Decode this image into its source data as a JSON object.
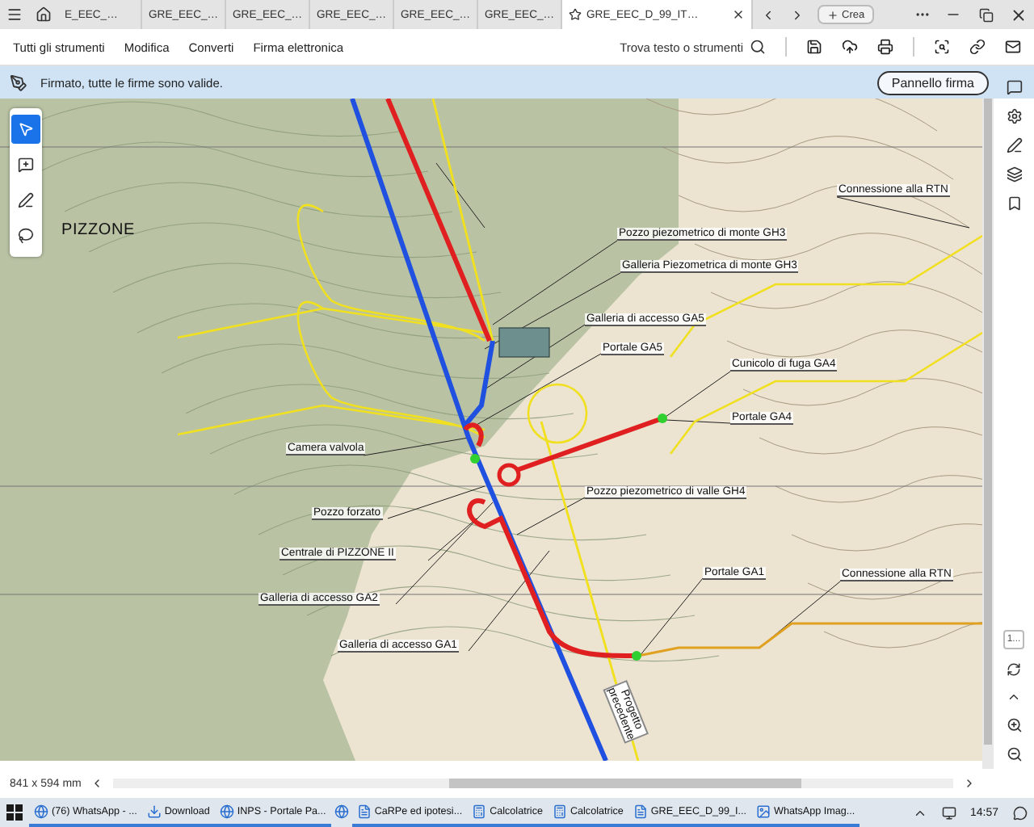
{
  "tabs": [
    {
      "label": "E_EEC_…",
      "selected": false
    },
    {
      "label": "GRE_EEC_…",
      "selected": false
    },
    {
      "label": "GRE_EEC_…",
      "selected": false
    },
    {
      "label": "GRE_EEC_…",
      "selected": false
    },
    {
      "label": "GRE_EEC_…",
      "selected": false
    },
    {
      "label": "GRE_EEC_…",
      "selected": false
    },
    {
      "label": "GRE_EEC_D_99_IT…",
      "selected": true
    }
  ],
  "create_button": "Crea",
  "menu": [
    "Tutti gli strumenti",
    "Modifica",
    "Converti",
    "Firma elettronica"
  ],
  "search": {
    "placeholder": "Trova testo o strumenti"
  },
  "signature_bar": {
    "message": "Firmato, tutte le firme sono valide.",
    "button": "Pannello firma"
  },
  "tools": [
    {
      "selected": true
    },
    {
      "selected": false
    },
    {
      "selected": false
    },
    {
      "selected": false
    }
  ],
  "map": {
    "labels": [
      {
        "kind": "place",
        "text": "PIZZONE"
      },
      {
        "kind": "callout",
        "text": "Connessione alla RTN"
      },
      {
        "kind": "callout",
        "text": "Pozzo piezometrico di  monte GH3"
      },
      {
        "kind": "callout",
        "text": "Galleria Piezometrica di  monte GH3"
      },
      {
        "kind": "callout",
        "text": "Galleria di accesso GA5"
      },
      {
        "kind": "callout",
        "text": "Portale GA5"
      },
      {
        "kind": "callout",
        "text": "Cunicolo di fuga GA4"
      },
      {
        "kind": "callout",
        "text": "Portale GA4"
      },
      {
        "kind": "callout",
        "text": "Camera valvola"
      },
      {
        "kind": "callout",
        "text": "Pozzo piezometrico di valle GH4"
      },
      {
        "kind": "callout",
        "text": "Pozzo forzato"
      },
      {
        "kind": "callout",
        "text": "Centrale di PIZZONE II"
      },
      {
        "kind": "callout",
        "text": "Portale GA1"
      },
      {
        "kind": "callout",
        "text": "Connessione alla RTN"
      },
      {
        "kind": "callout",
        "text": "Galleria di accesso GA2"
      },
      {
        "kind": "callout",
        "text": "Galleria di accesso GA1"
      },
      {
        "kind": "rotated",
        "text": "Progetto precedente"
      }
    ]
  },
  "page_field": {
    "value": "1..."
  },
  "status": {
    "page_size": "841 x 594 mm"
  },
  "taskbar": {
    "items": [
      {
        "kind": "app",
        "label": "(76) WhatsApp - ..."
      },
      {
        "kind": "app",
        "label": "Download"
      },
      {
        "kind": "app",
        "label": "INPS - Portale Pa..."
      },
      {
        "kind": "icon"
      },
      {
        "kind": "app",
        "label": "CaRPe ed ipotesi..."
      },
      {
        "kind": "app",
        "label": "Calcolatrice"
      },
      {
        "kind": "app",
        "label": "Calcolatrice"
      },
      {
        "kind": "app",
        "label": "GRE_EEC_D_99_I..."
      },
      {
        "kind": "app",
        "label": "WhatsApp Imag..."
      }
    ],
    "time": "14:57"
  }
}
